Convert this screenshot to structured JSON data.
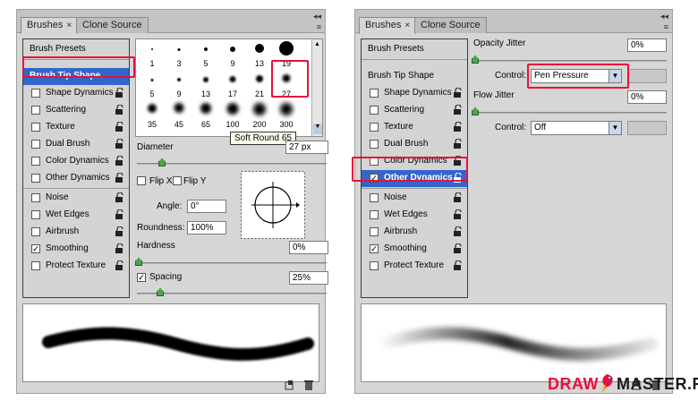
{
  "tabs": {
    "brushes": "Brushes",
    "clone_source": "Clone Source",
    "close": "×"
  },
  "list": {
    "presets": "Brush Presets",
    "tip_shape": "Brush Tip Shape",
    "items": [
      "Shape Dynamics",
      "Scattering",
      "Texture",
      "Dual Brush",
      "Color Dynamics",
      "Other Dynamics"
    ],
    "extras": [
      "Noise",
      "Wet Edges",
      "Airbrush",
      "Smoothing",
      "Protect Texture"
    ]
  },
  "brush_grid": {
    "rows": [
      [
        "1",
        "3",
        "5",
        "9",
        "13",
        "19"
      ],
      [
        "5",
        "9",
        "13",
        "17",
        "21",
        "27"
      ],
      [
        "35",
        "45",
        "65",
        "100",
        "200",
        "300"
      ]
    ],
    "tooltip": "Soft Round 65"
  },
  "tip": {
    "diameter_label": "Diameter",
    "diameter_value": "27 px",
    "flip_x": "Flip X",
    "flip_y": "Flip Y",
    "angle_label": "Angle:",
    "angle_value": "0°",
    "roundness_label": "Roundness:",
    "roundness_value": "100%",
    "hardness_label": "Hardness",
    "hardness_value": "0%",
    "spacing_label": "Spacing",
    "spacing_value": "25%"
  },
  "other_dynamics": {
    "opacity_label": "Opacity Jitter",
    "opacity_value": "0%",
    "control_label": "Control:",
    "control_opacity": "Pen Pressure",
    "flow_label": "Flow Jitter",
    "flow_value": "0%",
    "control_flow": "Off"
  },
  "watermark": {
    "draw": "DRAW",
    "master": "MASTER.RU"
  },
  "colors": {
    "highlight": "#3366cc",
    "callout": "#e8103a",
    "slider_thumb": "#4aa64a"
  }
}
